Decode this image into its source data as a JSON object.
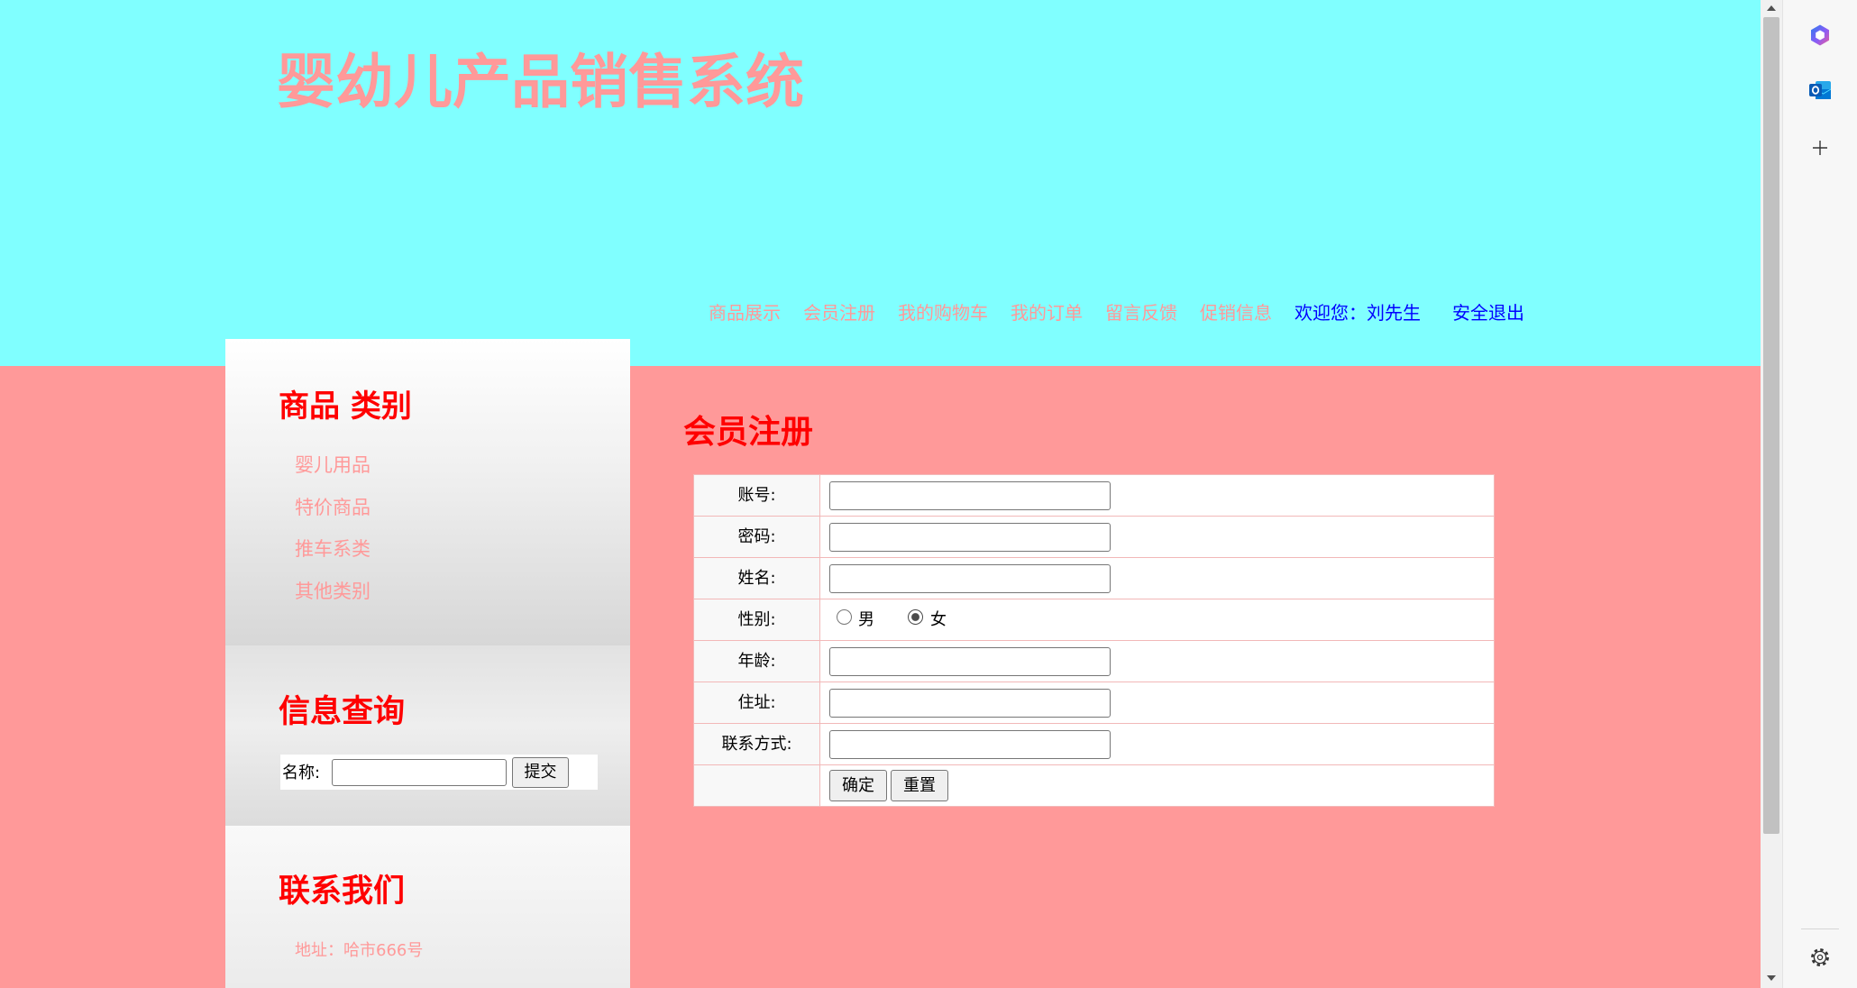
{
  "colors": {
    "header_bg": "#80ffff",
    "body_bg": "#ff9999",
    "title": "#ff9999",
    "heading": "#ff0000",
    "link": "#ff9999",
    "user_link": "#0000ff"
  },
  "header": {
    "title": "婴幼儿产品销售系统",
    "nav": [
      "商品展示",
      "会员注册",
      "我的购物车",
      "我的订单",
      "留言反馈",
      "促销信息"
    ],
    "welcome": "欢迎您：刘先生",
    "logout": "安全退出"
  },
  "sidebar": {
    "categories": {
      "title": "商品 类别",
      "items": [
        "婴儿用品",
        "特价商品",
        "推车系类",
        "其他类别"
      ]
    },
    "search": {
      "title": "信息查询",
      "label": "名称:",
      "value": "",
      "button": "提交"
    },
    "contact": {
      "title": "联系我们",
      "address": "地址：哈市666号"
    }
  },
  "main": {
    "title": "会员注册",
    "form": {
      "fields": [
        {
          "label": "账号:",
          "value": ""
        },
        {
          "label": "密码:",
          "value": ""
        },
        {
          "label": "姓名:",
          "value": ""
        },
        {
          "label": "性别:",
          "options": [
            "男",
            "女"
          ],
          "selected_index": 1
        },
        {
          "label": "年龄:",
          "value": ""
        },
        {
          "label": "住址:",
          "value": ""
        },
        {
          "label": "联系方式:",
          "value": ""
        }
      ],
      "submit": "确定",
      "reset": "重置"
    }
  },
  "browser": {
    "sidebar_icons": [
      "copilot-icon",
      "outlook-icon",
      "add-icon",
      "settings-gear-icon"
    ]
  }
}
